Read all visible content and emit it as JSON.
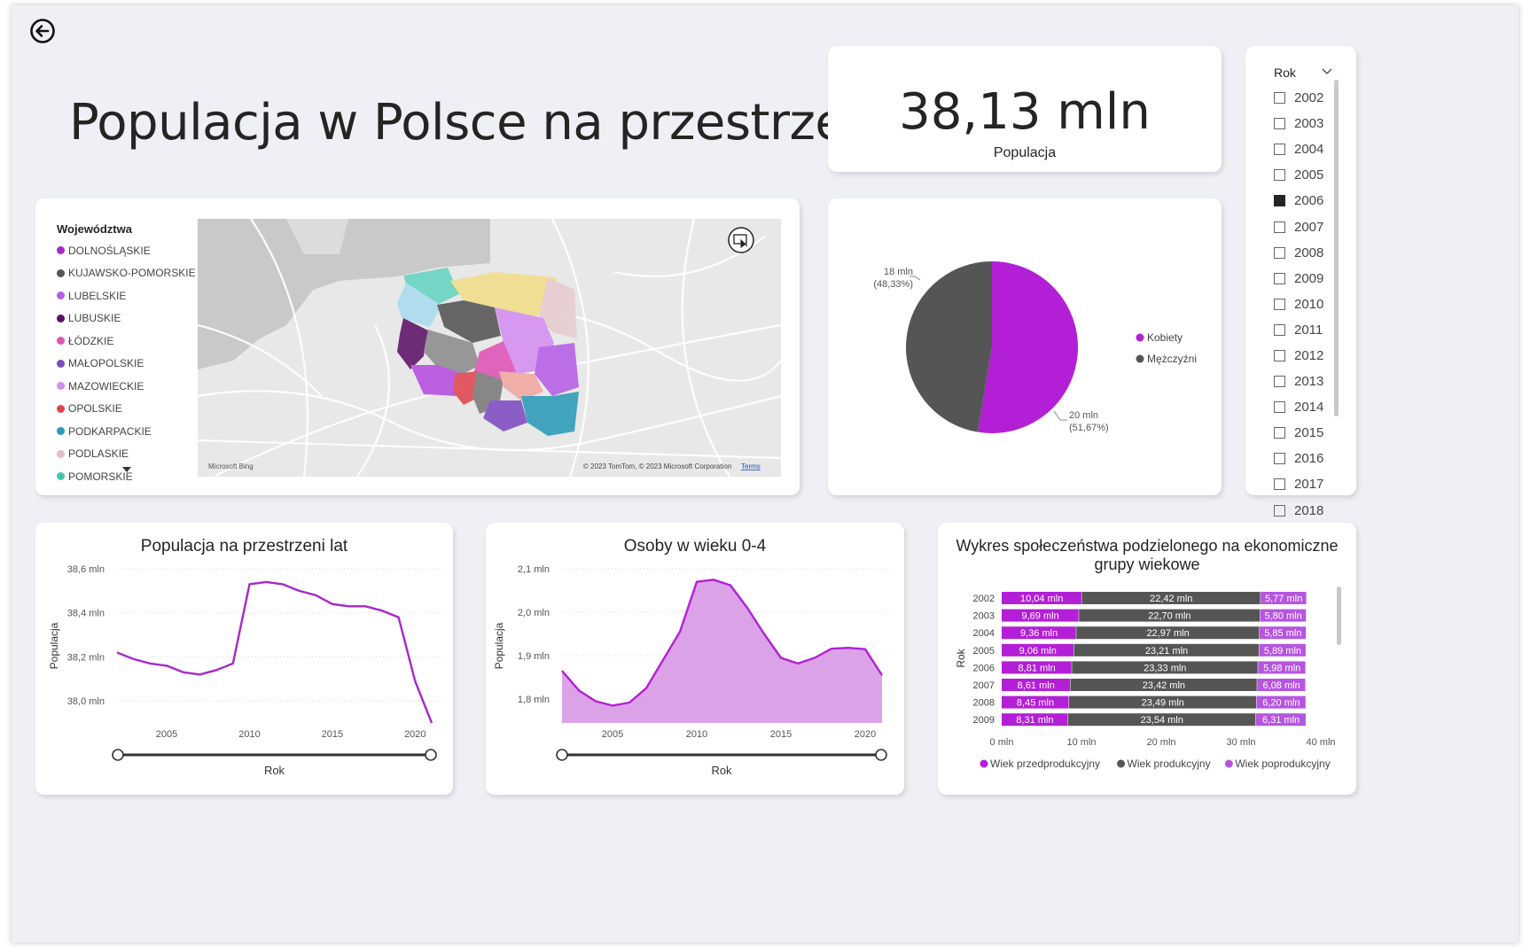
{
  "header": {
    "title": "Populacja w Polsce na przestrzeni lat"
  },
  "kpi": {
    "value": "38,13 mln",
    "label": "Populacja"
  },
  "map": {
    "legend_title": "Województwa",
    "legend": [
      {
        "label": "DOLNOŚLĄSKIE",
        "color": "#a629c9"
      },
      {
        "label": "KUJAWSKO-POMORSKIE",
        "color": "#555555"
      },
      {
        "label": "LUBELSKIE",
        "color": "#b65ee6"
      },
      {
        "label": "LUBUSKIE",
        "color": "#5c1467"
      },
      {
        "label": "ŁÓDZKIE",
        "color": "#e052b5"
      },
      {
        "label": "MAŁOPOLSKIE",
        "color": "#7f4cc3"
      },
      {
        "label": "MAZOWIECKIE",
        "color": "#d48ff0"
      },
      {
        "label": "OPOLSKIE",
        "color": "#e0454f"
      },
      {
        "label": "PODKARPACKIE",
        "color": "#2b9bb7"
      },
      {
        "label": "PODLASKIE",
        "color": "#e0c0c6"
      },
      {
        "label": "POMORSKIE",
        "color": "#44c4b0"
      }
    ],
    "attribution": "© 2023 TomTom, © 2023 Microsoft Corporation",
    "terms": "Terms",
    "bing": "Microsoft Bing"
  },
  "pie": {
    "chart_data": {
      "type": "pie",
      "slices": [
        {
          "name": "Kobiety",
          "value": 20,
          "label": "20 mln",
          "pct": "(51,67%)",
          "color": "#b31fd6"
        },
        {
          "name": "Mężczyźni",
          "value": 18,
          "label": "18 mln",
          "pct": "(48,33%)",
          "color": "#555555"
        }
      ],
      "legend_position": "right"
    }
  },
  "slicer": {
    "header": "Rok",
    "items": [
      "2002",
      "2003",
      "2004",
      "2005",
      "2006",
      "2007",
      "2008",
      "2009",
      "2010",
      "2011",
      "2012",
      "2013",
      "2014",
      "2015",
      "2016",
      "2017",
      "2018"
    ],
    "selected": "2006"
  },
  "line_pop": {
    "title": "Populacja na przestrzeni lat",
    "chart_data": {
      "type": "line",
      "x": [
        2002,
        2003,
        2004,
        2005,
        2006,
        2007,
        2008,
        2009,
        2010,
        2011,
        2012,
        2013,
        2014,
        2015,
        2016,
        2017,
        2018,
        2019,
        2020,
        2021
      ],
      "y": [
        38.22,
        38.19,
        38.17,
        38.16,
        38.13,
        38.12,
        38.14,
        38.17,
        38.53,
        38.54,
        38.53,
        38.5,
        38.48,
        38.44,
        38.43,
        38.43,
        38.41,
        38.38,
        38.09,
        37.9
      ],
      "xlabel": "Rok",
      "ylabel": "Populacja",
      "xticks": [
        "2005",
        "2010",
        "2015",
        "2020"
      ],
      "yticks": [
        "38,0 mln",
        "38,2 mln",
        "38,4 mln",
        "38,6 mln"
      ],
      "ylim": [
        37.9,
        38.6
      ],
      "color": "#a629c9"
    },
    "slider": {
      "xlabel": "Rok"
    }
  },
  "area_kids": {
    "title": "Osoby w wieku 0-4",
    "chart_data": {
      "type": "area",
      "x": [
        2002,
        2003,
        2004,
        2005,
        2006,
        2007,
        2008,
        2009,
        2010,
        2011,
        2012,
        2013,
        2014,
        2015,
        2016,
        2017,
        2018,
        2019,
        2020,
        2021
      ],
      "y": [
        1.865,
        1.82,
        1.795,
        1.785,
        1.792,
        1.825,
        1.89,
        1.955,
        2.07,
        2.075,
        2.062,
        2.01,
        1.95,
        1.895,
        1.882,
        1.895,
        1.916,
        1.918,
        1.915,
        1.855
      ],
      "xlabel": "Rok",
      "ylabel": "Populacja",
      "xticks": [
        "2005",
        "2010",
        "2015",
        "2020"
      ],
      "yticks": [
        "1,8 mln",
        "1,9 mln",
        "2,0 mln",
        "2,1 mln"
      ],
      "ylim": [
        1.745,
        2.1
      ],
      "color": "#b31fd6",
      "fill": "#dca2e8"
    },
    "slider": {
      "xlabel": "Rok"
    }
  },
  "bar_groups": {
    "title_line1": "Wykres społeczeństwa podzielonego na ekonomiczne",
    "title_line2": "grupy wiekowe",
    "chart_data": {
      "type": "bar",
      "categories": [
        "2002",
        "2003",
        "2004",
        "2005",
        "2006",
        "2007",
        "2008",
        "2009"
      ],
      "series": [
        {
          "name": "Wiek przedprodukcyjny",
          "values": [
            10.04,
            9.69,
            9.36,
            9.06,
            8.81,
            8.61,
            8.45,
            8.31
          ],
          "labels": [
            "10,04 mln",
            "9,69 mln",
            "9,36 mln",
            "9,06 mln",
            "8,81 mln",
            "8,61 mln",
            "8,45 mln",
            "8,31 mln"
          ],
          "color": "#b31fd6"
        },
        {
          "name": "Wiek produkcyjny",
          "values": [
            22.42,
            22.7,
            22.97,
            23.21,
            23.33,
            23.42,
            23.49,
            23.54
          ],
          "labels": [
            "22,42 mln",
            "22,70 mln",
            "22,97 mln",
            "23,21 mln",
            "23,33 mln",
            "23,42 mln",
            "23,49 mln",
            "23,54 mln"
          ],
          "color": "#555555"
        },
        {
          "name": "Wiek poprodukcyjny",
          "values": [
            5.77,
            5.8,
            5.85,
            5.89,
            5.98,
            6.08,
            6.2,
            6.31
          ],
          "labels": [
            "5,77 mln",
            "5,80 mln",
            "5,85 mln",
            "5,89 mln",
            "5,98 mln",
            "6,08 mln",
            "6,20 mln",
            "6,31 mln"
          ],
          "color": "#b655e0"
        }
      ],
      "ylabel": "Rok",
      "xticks": [
        "0 mln",
        "10 mln",
        "20 mln",
        "30 mln",
        "40 mln"
      ],
      "xlim": [
        0,
        40
      ],
      "legend_position": "bottom"
    }
  }
}
